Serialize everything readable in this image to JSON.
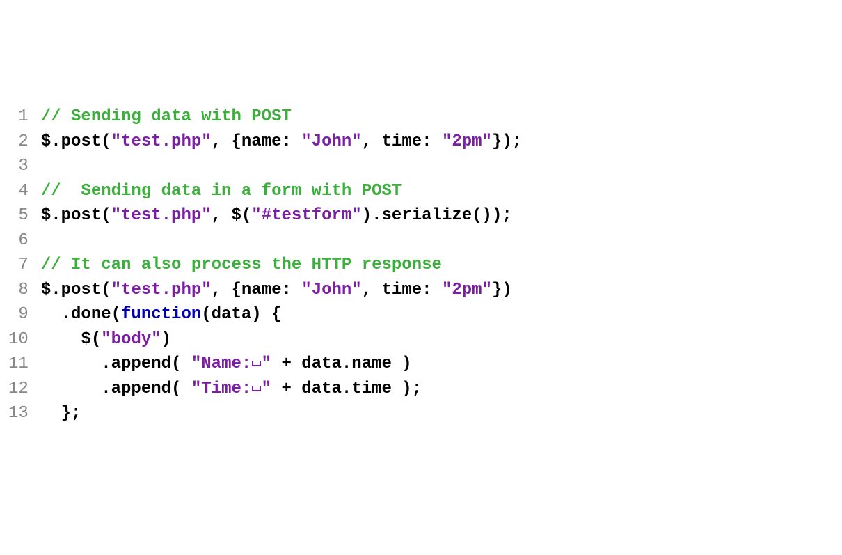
{
  "code": {
    "lines": [
      {
        "num": "1",
        "tokens": [
          {
            "cls": "c-comment",
            "text": "// Sending data with POST"
          }
        ]
      },
      {
        "num": "2",
        "tokens": [
          {
            "cls": "c-default",
            "text": "$.post("
          },
          {
            "cls": "c-string",
            "text": "\"test.php\""
          },
          {
            "cls": "c-default",
            "text": ", {name: "
          },
          {
            "cls": "c-string",
            "text": "\"John\""
          },
          {
            "cls": "c-default",
            "text": ", time: "
          },
          {
            "cls": "c-string",
            "text": "\"2pm\""
          },
          {
            "cls": "c-default",
            "text": "});"
          }
        ]
      },
      {
        "num": "3",
        "tokens": [
          {
            "cls": "c-default",
            "text": ""
          }
        ]
      },
      {
        "num": "4",
        "tokens": [
          {
            "cls": "c-comment",
            "text": "//  Sending data in a form with POST"
          }
        ]
      },
      {
        "num": "5",
        "tokens": [
          {
            "cls": "c-default",
            "text": "$.post("
          },
          {
            "cls": "c-string",
            "text": "\"test.php\""
          },
          {
            "cls": "c-default",
            "text": ", $("
          },
          {
            "cls": "c-string",
            "text": "\"#testform\""
          },
          {
            "cls": "c-default",
            "text": ").serialize());"
          }
        ]
      },
      {
        "num": "6",
        "tokens": [
          {
            "cls": "c-default",
            "text": ""
          }
        ]
      },
      {
        "num": "7",
        "tokens": [
          {
            "cls": "c-comment",
            "text": "// It can also process the HTTP response"
          }
        ]
      },
      {
        "num": "8",
        "tokens": [
          {
            "cls": "c-default",
            "text": "$.post("
          },
          {
            "cls": "c-string",
            "text": "\"test.php\""
          },
          {
            "cls": "c-default",
            "text": ", {name: "
          },
          {
            "cls": "c-string",
            "text": "\"John\""
          },
          {
            "cls": "c-default",
            "text": ", time: "
          },
          {
            "cls": "c-string",
            "text": "\"2pm\""
          },
          {
            "cls": "c-default",
            "text": "})"
          }
        ]
      },
      {
        "num": "9",
        "tokens": [
          {
            "cls": "c-default",
            "text": "  .done("
          },
          {
            "cls": "c-keyword",
            "text": "function"
          },
          {
            "cls": "c-default",
            "text": "(data) {"
          }
        ]
      },
      {
        "num": "10",
        "tokens": [
          {
            "cls": "c-default",
            "text": "    $("
          },
          {
            "cls": "c-string",
            "text": "\"body\""
          },
          {
            "cls": "c-default",
            "text": ")"
          }
        ]
      },
      {
        "num": "11",
        "tokens": [
          {
            "cls": "c-default",
            "text": "      .append( "
          },
          {
            "cls": "c-string",
            "text": "\"Name:"
          },
          {
            "cls": "vis-space",
            "text": ""
          },
          {
            "cls": "c-string",
            "text": "\""
          },
          {
            "cls": "c-default",
            "text": " + data.name )"
          }
        ]
      },
      {
        "num": "12",
        "tokens": [
          {
            "cls": "c-default",
            "text": "      .append( "
          },
          {
            "cls": "c-string",
            "text": "\"Time:"
          },
          {
            "cls": "vis-space",
            "text": ""
          },
          {
            "cls": "c-string",
            "text": "\""
          },
          {
            "cls": "c-default",
            "text": " + data.time );"
          }
        ]
      },
      {
        "num": "13",
        "tokens": [
          {
            "cls": "c-default",
            "text": "  };"
          }
        ]
      }
    ]
  }
}
